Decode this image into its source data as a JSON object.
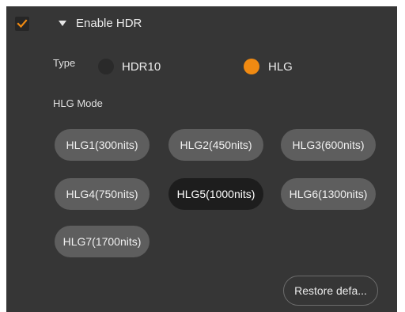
{
  "header": {
    "enable_hdr_checked": true,
    "title": "Enable HDR"
  },
  "type": {
    "label": "Type",
    "options": [
      {
        "label": "HDR10",
        "selected": false
      },
      {
        "label": "HLG",
        "selected": true
      }
    ]
  },
  "hlg_mode": {
    "label": "HLG Mode",
    "options": [
      {
        "label": "HLG1(300nits)",
        "selected": false
      },
      {
        "label": "HLG2(450nits)",
        "selected": false
      },
      {
        "label": "HLG3(600nits)",
        "selected": false
      },
      {
        "label": "HLG4(750nits)",
        "selected": false
      },
      {
        "label": "HLG5(1000nits)",
        "selected": true
      },
      {
        "label": "HLG6(1300nits)",
        "selected": false
      },
      {
        "label": "HLG7(1700nits)",
        "selected": false
      }
    ]
  },
  "restore_button": "Restore defa...",
  "colors": {
    "accent": "#f08a12",
    "panel_background": "#363636",
    "pill_background": "#5e5e5e",
    "pill_selected_background": "#1d1d1d"
  },
  "icons": {
    "checkbox": "checkmark-icon",
    "expander": "caret-down-icon"
  }
}
